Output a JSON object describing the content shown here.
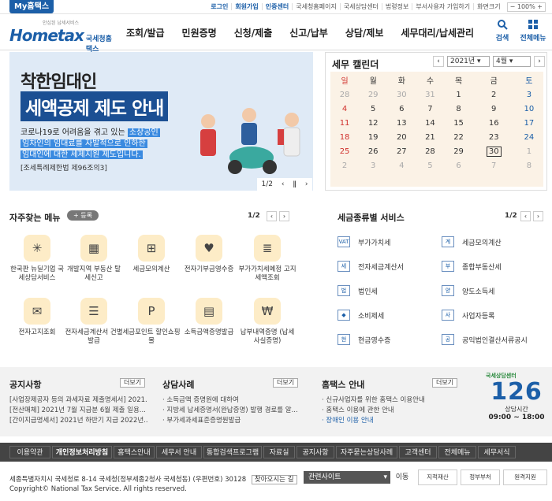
{
  "topbar": {
    "my_tab": "My홈택스",
    "links": [
      "로그인",
      "회원가입",
      "인증센터",
      "국세청홈페이지",
      "국세상담센터",
      "법령정보",
      "부서사용자 가입하기",
      "화면크기"
    ],
    "zoom": "100%"
  },
  "header": {
    "logo_small": "안심된 납세서비스",
    "logo_text": "Hometax",
    "logo_sub": "국세청홈택스",
    "gnb": [
      "조회/발급",
      "민원증명",
      "신청/제출",
      "신고/납부",
      "상담/제보",
      "세무대리/납세관리"
    ],
    "search_label": "검색",
    "menu_label": "전체메뉴"
  },
  "banner": {
    "title1": "착한임대인",
    "title2": "세액공제 제도 안내",
    "line1a": "코로나19로 어려움을 겪고 있는 ",
    "line1b": "소상공인",
    "line2": "임차인의 임대료를 자발적으로 인하한",
    "line3": "임대인에 대한 세제지원 제도입니다.",
    "ref": "[조세특례제한법 제96조의3]",
    "pager": "1/2"
  },
  "calendar": {
    "title": "세무 캘린더",
    "year": "2021년",
    "month": "4월",
    "weekdays": [
      "일",
      "월",
      "화",
      "수",
      "목",
      "금",
      "토"
    ],
    "weeks": [
      [
        "28",
        "29",
        "30",
        "31",
        "1",
        "2",
        "3"
      ],
      [
        "4",
        "5",
        "6",
        "7",
        "8",
        "9",
        "10"
      ],
      [
        "11",
        "12",
        "13",
        "14",
        "15",
        "16",
        "17"
      ],
      [
        "18",
        "19",
        "20",
        "21",
        "22",
        "23",
        "24"
      ],
      [
        "25",
        "26",
        "27",
        "28",
        "29",
        "30",
        "1"
      ],
      [
        "2",
        "3",
        "4",
        "5",
        "6",
        "7",
        "8"
      ]
    ]
  },
  "favorites": {
    "title": "자주찾는 메뉴",
    "add": "등록",
    "pager": "1/2",
    "items": [
      {
        "label": "한국판 뉴딜기업 국세상담서비스",
        "icon": "deal"
      },
      {
        "label": "개발지역 부동산 탈세신고",
        "icon": "building"
      },
      {
        "label": "세금모의계산",
        "icon": "calc"
      },
      {
        "label": "전자기부금영수증",
        "icon": "heart"
      },
      {
        "label": "부가가치세예정 고지세액조회",
        "icon": "doc"
      },
      {
        "label": "전자고지조회",
        "icon": "mail"
      },
      {
        "label": "전자세금계산서 건별발급",
        "icon": "invoice"
      },
      {
        "label": "세금포인트 할인쇼핑몰",
        "icon": "point"
      },
      {
        "label": "소득금액증명발급",
        "icon": "cert"
      },
      {
        "label": "납부내역증명 (납세사실증명)",
        "icon": "receipt"
      }
    ]
  },
  "tax_types": {
    "title": "세금종류별 서비스",
    "pager": "1/2",
    "items": [
      {
        "label": "부가가치세",
        "icon": "VAT"
      },
      {
        "label": "세금모의계산",
        "icon": "계"
      },
      {
        "label": "전자세금계산서",
        "icon": "세"
      },
      {
        "label": "종합부동산세",
        "icon": "부"
      },
      {
        "label": "법인세",
        "icon": "법"
      },
      {
        "label": "양도소득세",
        "icon": "양"
      },
      {
        "label": "소비제세",
        "icon": "◆"
      },
      {
        "label": "사업자등록",
        "icon": "사"
      },
      {
        "label": "현금영수증",
        "icon": "현"
      },
      {
        "label": "공익법인결산서류공시",
        "icon": "공"
      }
    ]
  },
  "notices": {
    "title": "공지사항",
    "more": "더보기",
    "items": [
      "[사업장제공자 등의 과세자료 제출명세서] 2021...",
      "[전산매체] 2021년 7월 지급분 6월 제출 일용...",
      "[간이지급명세서] 2021년 하반기 지급 2022년..."
    ]
  },
  "cases": {
    "title": "상담사례",
    "more": "더보기",
    "items": [
      "소득금액 증명원에 대하여",
      "지방세 납세증명서(완납증명) 발행 경로를 알...",
      "부가세과세표준증명원발급"
    ]
  },
  "guide": {
    "title": "홈택스 안내",
    "more": "더보기",
    "items": [
      "신규사업자를 위한 홈택스 이용안내",
      "홈택스 이용에 관한 안내",
      "장애인 이용 안내"
    ]
  },
  "hours": {
    "top": "국세상담센터",
    "number": "126",
    "label": "상담시간",
    "time": "09:00 ~ 18:00"
  },
  "footer": {
    "nav": [
      "이용약관",
      "개인정보처리방침",
      "홈택스안내",
      "세무서 안내",
      "통합검색프로그램",
      "자료실",
      "공지사항",
      "자주묻는상담사례",
      "고객센터",
      "전체메뉴",
      "세무서식"
    ],
    "address": "세종특별자치시 국세청로 8-14 국세청(정부세종2청사 국세청동) (우편번호) 30128",
    "directions": "찾아오시는 길",
    "copyright": "Copyright© National Tax Service. All rights reserved.",
    "related": "관련사이트",
    "go": "이동",
    "badges": [
      "지적재산",
      "정부부처",
      "원격지원"
    ]
  },
  "colors": {
    "primary": "#1c5fa8",
    "banner_bg": "#dfeaf6",
    "calendar_bg": "#fbf2e6",
    "sunday": "#d0312d"
  }
}
